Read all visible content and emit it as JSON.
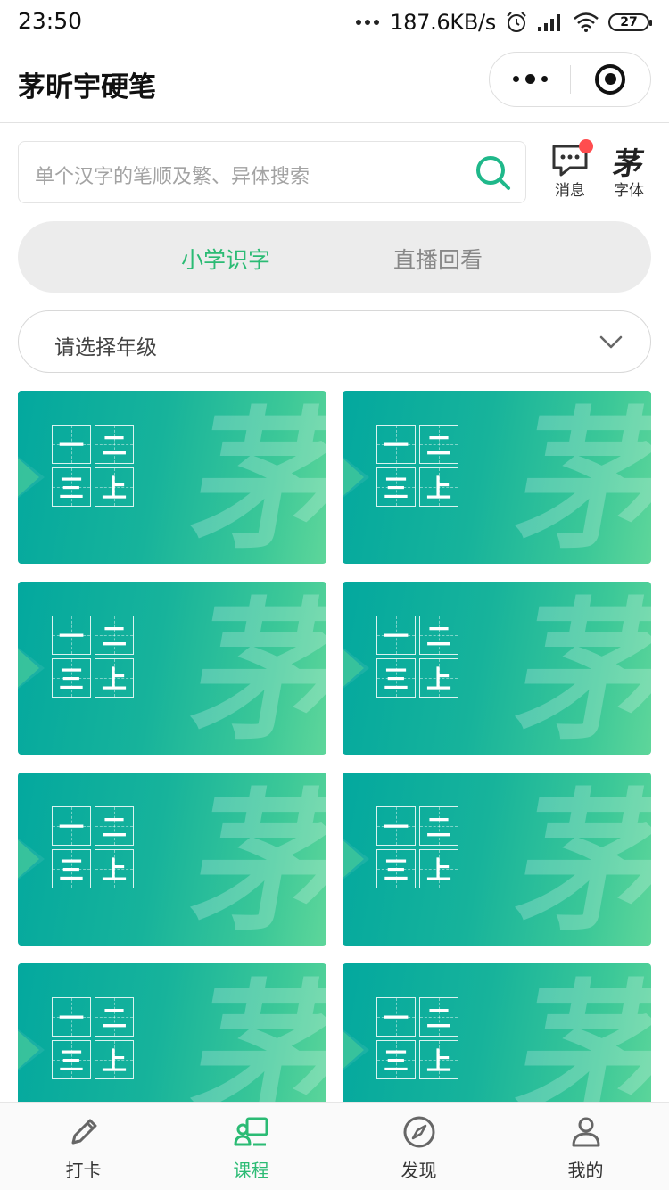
{
  "status_bar": {
    "time": "23:50",
    "speed": "187.6KB/s",
    "battery": "27"
  },
  "nav": {
    "title": "茅昕宇硬笔"
  },
  "search": {
    "placeholder": "单个汉字的笔顺及繁、异体搜索"
  },
  "side_buttons": {
    "messages_label": "消息",
    "font_label": "字体",
    "font_glyph": "茅"
  },
  "tabs": [
    {
      "label": "小学识字",
      "active": true
    },
    {
      "label": "直播回看",
      "active": false
    }
  ],
  "grade_select": {
    "placeholder": "请选择年级"
  },
  "cards": [
    {
      "chars": [
        "一",
        "二",
        "三",
        "上"
      ],
      "watermark": "茅"
    },
    {
      "chars": [
        "一",
        "二",
        "三",
        "上"
      ],
      "watermark": "茅"
    },
    {
      "chars": [
        "一",
        "二",
        "三",
        "上"
      ],
      "watermark": "茅"
    },
    {
      "chars": [
        "一",
        "二",
        "三",
        "上"
      ],
      "watermark": "茅"
    },
    {
      "chars": [
        "一",
        "二",
        "三",
        "上"
      ],
      "watermark": "茅"
    },
    {
      "chars": [
        "一",
        "二",
        "三",
        "上"
      ],
      "watermark": "茅"
    },
    {
      "chars": [
        "一",
        "二",
        "三",
        "上"
      ],
      "watermark": "茅"
    },
    {
      "chars": [
        "一",
        "二",
        "三",
        "上"
      ],
      "watermark": "茅"
    }
  ],
  "tabbar": [
    {
      "label": "打卡",
      "icon": "pen-icon",
      "active": false
    },
    {
      "label": "课程",
      "icon": "course-icon",
      "active": true
    },
    {
      "label": "发现",
      "icon": "compass-icon",
      "active": false
    },
    {
      "label": "我的",
      "icon": "user-icon",
      "active": false
    }
  ],
  "colors": {
    "accent": "#2bbb74",
    "card_gradient_start": "#03a89e",
    "card_gradient_end": "#5ed69a",
    "badge": "#ff4d4f"
  }
}
